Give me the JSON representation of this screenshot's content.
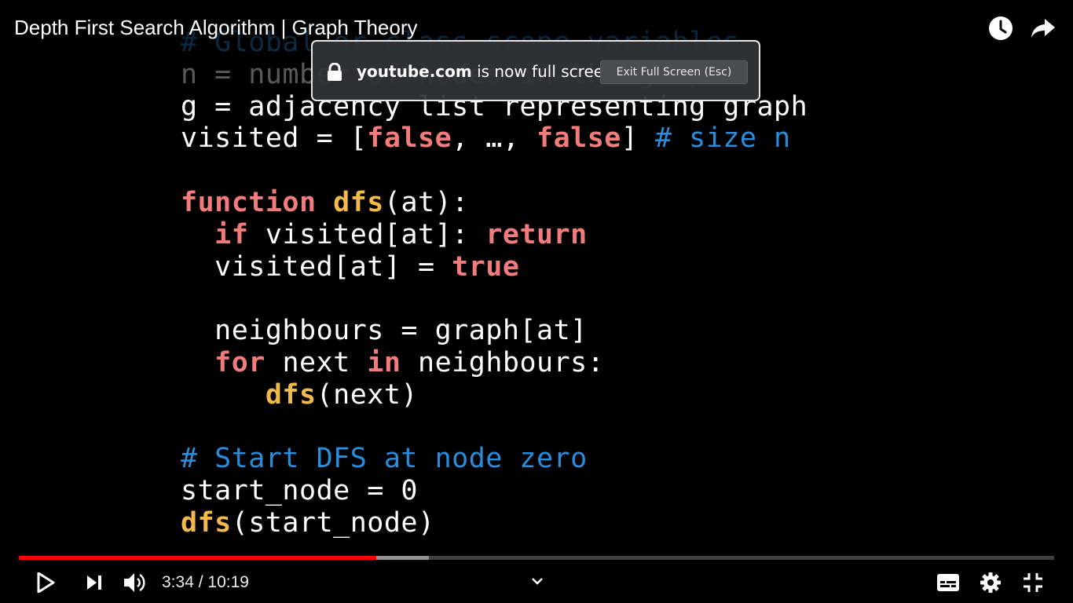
{
  "video": {
    "title": "Depth First Search Algorithm | Graph Theory",
    "code_lines": [
      [
        {
          "t": "# Global or class scope variables",
          "c": "cm",
          "faded": true
        }
      ],
      [
        {
          "t": "n = number of nodes in the graph",
          "c": "pl",
          "faded": true
        }
      ],
      [
        {
          "t": "g = adjacency list representing graph",
          "c": "pl"
        }
      ],
      [
        {
          "t": "visited = [",
          "c": "pl"
        },
        {
          "t": "false",
          "c": "kw"
        },
        {
          "t": ", …, ",
          "c": "pl"
        },
        {
          "t": "false",
          "c": "kw"
        },
        {
          "t": "] ",
          "c": "pl"
        },
        {
          "t": "# size n",
          "c": "cm"
        }
      ],
      [
        {
          "t": "",
          "c": "pl"
        }
      ],
      [
        {
          "t": "function ",
          "c": "kw"
        },
        {
          "t": "dfs",
          "c": "fn"
        },
        {
          "t": "(at):",
          "c": "pl"
        }
      ],
      [
        {
          "t": "  ",
          "c": "pl"
        },
        {
          "t": "if",
          "c": "kw"
        },
        {
          "t": " visited[at]: ",
          "c": "pl"
        },
        {
          "t": "return",
          "c": "kw"
        }
      ],
      [
        {
          "t": "  visited[at] = ",
          "c": "pl"
        },
        {
          "t": "true",
          "c": "kw"
        }
      ],
      [
        {
          "t": "",
          "c": "pl"
        }
      ],
      [
        {
          "t": "  neighbours = graph[at]",
          "c": "pl"
        }
      ],
      [
        {
          "t": "  ",
          "c": "pl"
        },
        {
          "t": "for",
          "c": "kw"
        },
        {
          "t": " next ",
          "c": "pl"
        },
        {
          "t": "in",
          "c": "kw"
        },
        {
          "t": " neighbours:",
          "c": "pl"
        }
      ],
      [
        {
          "t": "     ",
          "c": "pl"
        },
        {
          "t": "dfs",
          "c": "fn"
        },
        {
          "t": "(next)",
          "c": "pl"
        }
      ],
      [
        {
          "t": "",
          "c": "pl"
        }
      ],
      [
        {
          "t": "# Start DFS at node zero",
          "c": "cm"
        }
      ],
      [
        {
          "t": "start_node = 0",
          "c": "pl"
        }
      ],
      [
        {
          "t": "dfs",
          "c": "fn"
        },
        {
          "t": "(start_node)",
          "c": "pl"
        }
      ]
    ]
  },
  "fullscreen_notice": {
    "domain": "youtube.com",
    "message": " is now full screen",
    "exit_label": "Exit Full Screen (Esc)"
  },
  "controls": {
    "current_time": "3:34",
    "separator": " / ",
    "duration": "10:19",
    "progress_fraction": 0.345,
    "buffered_fraction": 0.396,
    "icons": [
      "play-icon",
      "next-icon",
      "volume-icon",
      "chevron-down-icon",
      "subtitles-icon",
      "settings-icon",
      "exit-fullscreen-icon",
      "watch-later-icon",
      "share-icon"
    ]
  },
  "colors": {
    "progress": "#ff0000",
    "keyword": "#f27c7c",
    "function": "#f2b94b",
    "comment": "#2a8ddc"
  }
}
